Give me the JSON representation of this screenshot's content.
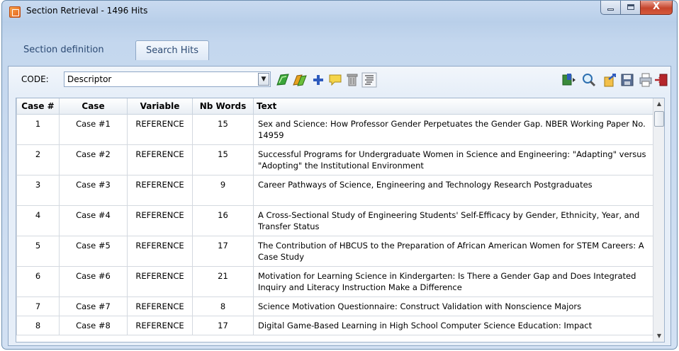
{
  "window": {
    "title": "Section Retrieval - 1496 Hits",
    "close_glyph": "X"
  },
  "tabs": [
    "Section definition",
    "Search Hits"
  ],
  "toolbar": {
    "code_label": "CODE:",
    "code_value": "Descriptor",
    "icons": [
      "tag-green-icon",
      "tag-multi-icon",
      "add-icon",
      "comment-icon",
      "delete-icon",
      "format-icon",
      "export-excel-icon",
      "zoom-icon",
      "report-icon",
      "save-icon",
      "print-icon",
      "exit-icon"
    ]
  },
  "table": {
    "columns": [
      "Case #",
      "Case",
      "Variable",
      "Nb Words",
      "Text"
    ],
    "rows": [
      {
        "num": "1",
        "case": "Case #1",
        "variable": "REFERENCE",
        "words": "15",
        "text": "Sex and Science: How Professor Gender Perpetuates the Gender Gap. NBER Working Paper No. 14959"
      },
      {
        "num": "2",
        "case": "Case #2",
        "variable": "REFERENCE",
        "words": "15",
        "text": "Successful Programs for Undergraduate Women in Science and Engineering: \"Adapting\" versus \"Adopting\" the Institutional Environment"
      },
      {
        "num": "3",
        "case": "Case #3",
        "variable": "REFERENCE",
        "words": "9",
        "text": "Career Pathways of Science, Engineering and Technology Research Postgraduates"
      },
      {
        "num": "4",
        "case": "Case #4",
        "variable": "REFERENCE",
        "words": "16",
        "text": "A Cross-Sectional Study of Engineering Students' Self-Efficacy by Gender, Ethnicity, Year, and Transfer Status"
      },
      {
        "num": "5",
        "case": "Case #5",
        "variable": "REFERENCE",
        "words": "17",
        "text": "The Contribution of HBCUS to the Preparation of African American Women for STEM Careers: A Case Study"
      },
      {
        "num": "6",
        "case": "Case #6",
        "variable": "REFERENCE",
        "words": "21",
        "text": "Motivation for Learning Science in Kindergarten: Is There a Gender Gap and Does Integrated Inquiry and Literacy Instruction Make a Difference"
      },
      {
        "num": "7",
        "case": "Case #7",
        "variable": "REFERENCE",
        "words": "8",
        "text": "Science Motivation Questionnaire: Construct Validation with Nonscience Majors"
      },
      {
        "num": "8",
        "case": "Case #8",
        "variable": "REFERENCE",
        "words": "17",
        "text": "Digital Game-Based Learning in High School Computer Science Education: Impact"
      }
    ]
  },
  "colors": {
    "tab_active_text": "#2c4a73",
    "close_button": "#c6452c",
    "frame": "#b9cfe9"
  }
}
